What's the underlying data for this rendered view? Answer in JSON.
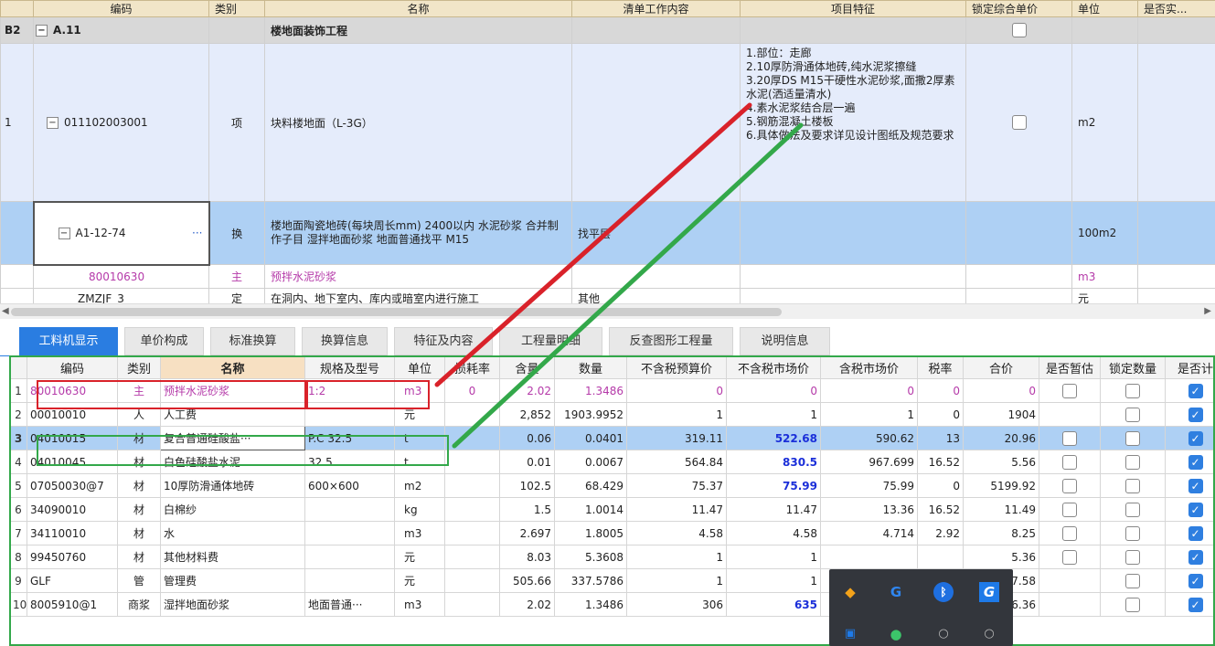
{
  "top_grid": {
    "header": {
      "c1": "编码",
      "c2": "类别",
      "c3": "名称",
      "c4": "清单工作内容",
      "c5": "项目特征",
      "c6": "锁定综合单价",
      "c7": "单位",
      "c8": "是否实..."
    },
    "section": {
      "index": "B2",
      "code": "A.11",
      "name": "楼地面装饰工程"
    },
    "item": {
      "index": "1",
      "code": "011102003001",
      "type": "项",
      "name": "块料楼地面（L-3G）",
      "description": "1.部位：走廊\n2.10厚防滑通体地砖,纯水泥浆擦缝\n3.20厚DS M15干硬性水泥砂浆,面撒2厚素水泥(洒适量清水)\n4.素水泥浆结合层一遍\n5.钢筋混凝土楼板\n6.具体做法及要求详见设计图纸及规范要求",
      "unit": "m2"
    },
    "sub_selected": {
      "code": "A1-12-74",
      "ellipsis": "···",
      "type": "换",
      "name": "楼地面陶瓷地砖(每块周长mm) 2400以内 水泥砂浆 合并制作子目 湿拌地面砂浆 地面普通找平 M15",
      "work": "找平层",
      "unit": "100m2"
    },
    "sub2": {
      "code": "80010630",
      "type": "主",
      "name": "预拌水泥砂浆",
      "unit": "m3"
    },
    "sub3": {
      "code": "ZMZJF_3",
      "type": "定",
      "name": "在洞内、地下室内、库内或暗室内进行施工",
      "work": "其他",
      "unit": "元"
    }
  },
  "scrollbar": {
    "left_arrow": "◀",
    "right_arrow": "▶"
  },
  "tabs": [
    "工料机显示",
    "单价构成",
    "标准换算",
    "换算信息",
    "特征及内容",
    "工程量明细",
    "反查图形工程量",
    "说明信息"
  ],
  "bottom_grid": {
    "headers": [
      "",
      "编码",
      "类别",
      "名称",
      "规格及型号",
      "单位",
      "损耗率",
      "含量",
      "数量",
      "不含税预算价",
      "不含税市场价",
      "含税市场价",
      "税率",
      "合价",
      "是否暂估",
      "锁定数量",
      "是否计"
    ],
    "rows": [
      {
        "i": "1",
        "code": "80010630",
        "type": "主",
        "name": "预拌水泥砂浆",
        "spec": "1:2",
        "unit": "m3",
        "loss": "0",
        "content": "2.02",
        "qty": "1.3486",
        "budget": "0",
        "market": "0",
        "tax_market": "0",
        "rate": "0",
        "total": "0"
      },
      {
        "i": "2",
        "code": "00010010",
        "type": "人",
        "name": "人工费",
        "spec": "",
        "unit": "元",
        "loss": "",
        "content": "2,852",
        "qty": "1903.9952",
        "budget": "1",
        "market": "1",
        "tax_market": "1",
        "rate": "0",
        "total": "1904"
      },
      {
        "i": "3",
        "code": "04010015",
        "type": "材",
        "name": "复合普通硅酸盐···",
        "spec": "P.C 32.5",
        "unit": "t",
        "loss": "",
        "content": "0.06",
        "qty": "0.0401",
        "budget": "319.11",
        "market": "522.68",
        "tax_market": "590.62",
        "rate": "13",
        "total": "20.96"
      },
      {
        "i": "4",
        "code": "04010045",
        "type": "材",
        "name": "白色硅酸盐水泥",
        "spec": "32.5",
        "unit": "t",
        "loss": "",
        "content": "0.01",
        "qty": "0.0067",
        "budget": "564.84",
        "market": "830.5",
        "tax_market": "967.699",
        "rate": "16.52",
        "total": "5.56"
      },
      {
        "i": "5",
        "code": "07050030@7",
        "type": "材",
        "name": "10厚防滑通体地砖",
        "spec": "600×600",
        "unit": "m2",
        "loss": "",
        "content": "102.5",
        "qty": "68.429",
        "budget": "75.37",
        "market": "75.99",
        "tax_market": "75.99",
        "rate": "0",
        "total": "5199.92"
      },
      {
        "i": "6",
        "code": "34090010",
        "type": "材",
        "name": "白棉纱",
        "spec": "",
        "unit": "kg",
        "loss": "",
        "content": "1.5",
        "qty": "1.0014",
        "budget": "11.47",
        "market": "11.47",
        "tax_market": "13.36",
        "rate": "16.52",
        "total": "11.49"
      },
      {
        "i": "7",
        "code": "34110010",
        "type": "材",
        "name": "水",
        "spec": "",
        "unit": "m3",
        "loss": "",
        "content": "2.697",
        "qty": "1.8005",
        "budget": "4.58",
        "market": "4.58",
        "tax_market": "4.714",
        "rate": "2.92",
        "total": "8.25"
      },
      {
        "i": "8",
        "code": "99450760",
        "type": "材",
        "name": "其他材料费",
        "spec": "",
        "unit": "元",
        "loss": "",
        "content": "8.03",
        "qty": "5.3608",
        "budget": "1",
        "market": "1",
        "tax_market": "",
        "rate": "",
        "total": "5.36"
      },
      {
        "i": "9",
        "code": "GLF",
        "type": "管",
        "name": "管理费",
        "spec": "",
        "unit": "元",
        "loss": "",
        "content": "505.66",
        "qty": "337.5786",
        "budget": "1",
        "market": "1",
        "tax_market": "",
        "rate": "",
        "total": "37.58"
      },
      {
        "i": "10",
        "code": "8005910@1",
        "type": "商浆",
        "name": "湿拌地面砂浆",
        "spec": "地面普通···",
        "unit": "m3",
        "loss": "",
        "content": "2.02",
        "qty": "1.3486",
        "budget": "306",
        "market": "635",
        "tax_market": "",
        "rate": "",
        "total": "56.36"
      }
    ]
  },
  "colors": {
    "accent": "#2a7de1",
    "red_annotation": "#d9222a",
    "green_annotation": "#33a84a",
    "selected_row": "#aed0f4",
    "mauve_text": "#b53aa9"
  },
  "tray_icons": [
    "shield-icon",
    "g-icon",
    "bluetooth-icon",
    "g-blue-icon",
    "folder-icon",
    "wechat-icon",
    "user-icon",
    "user2-icon"
  ]
}
